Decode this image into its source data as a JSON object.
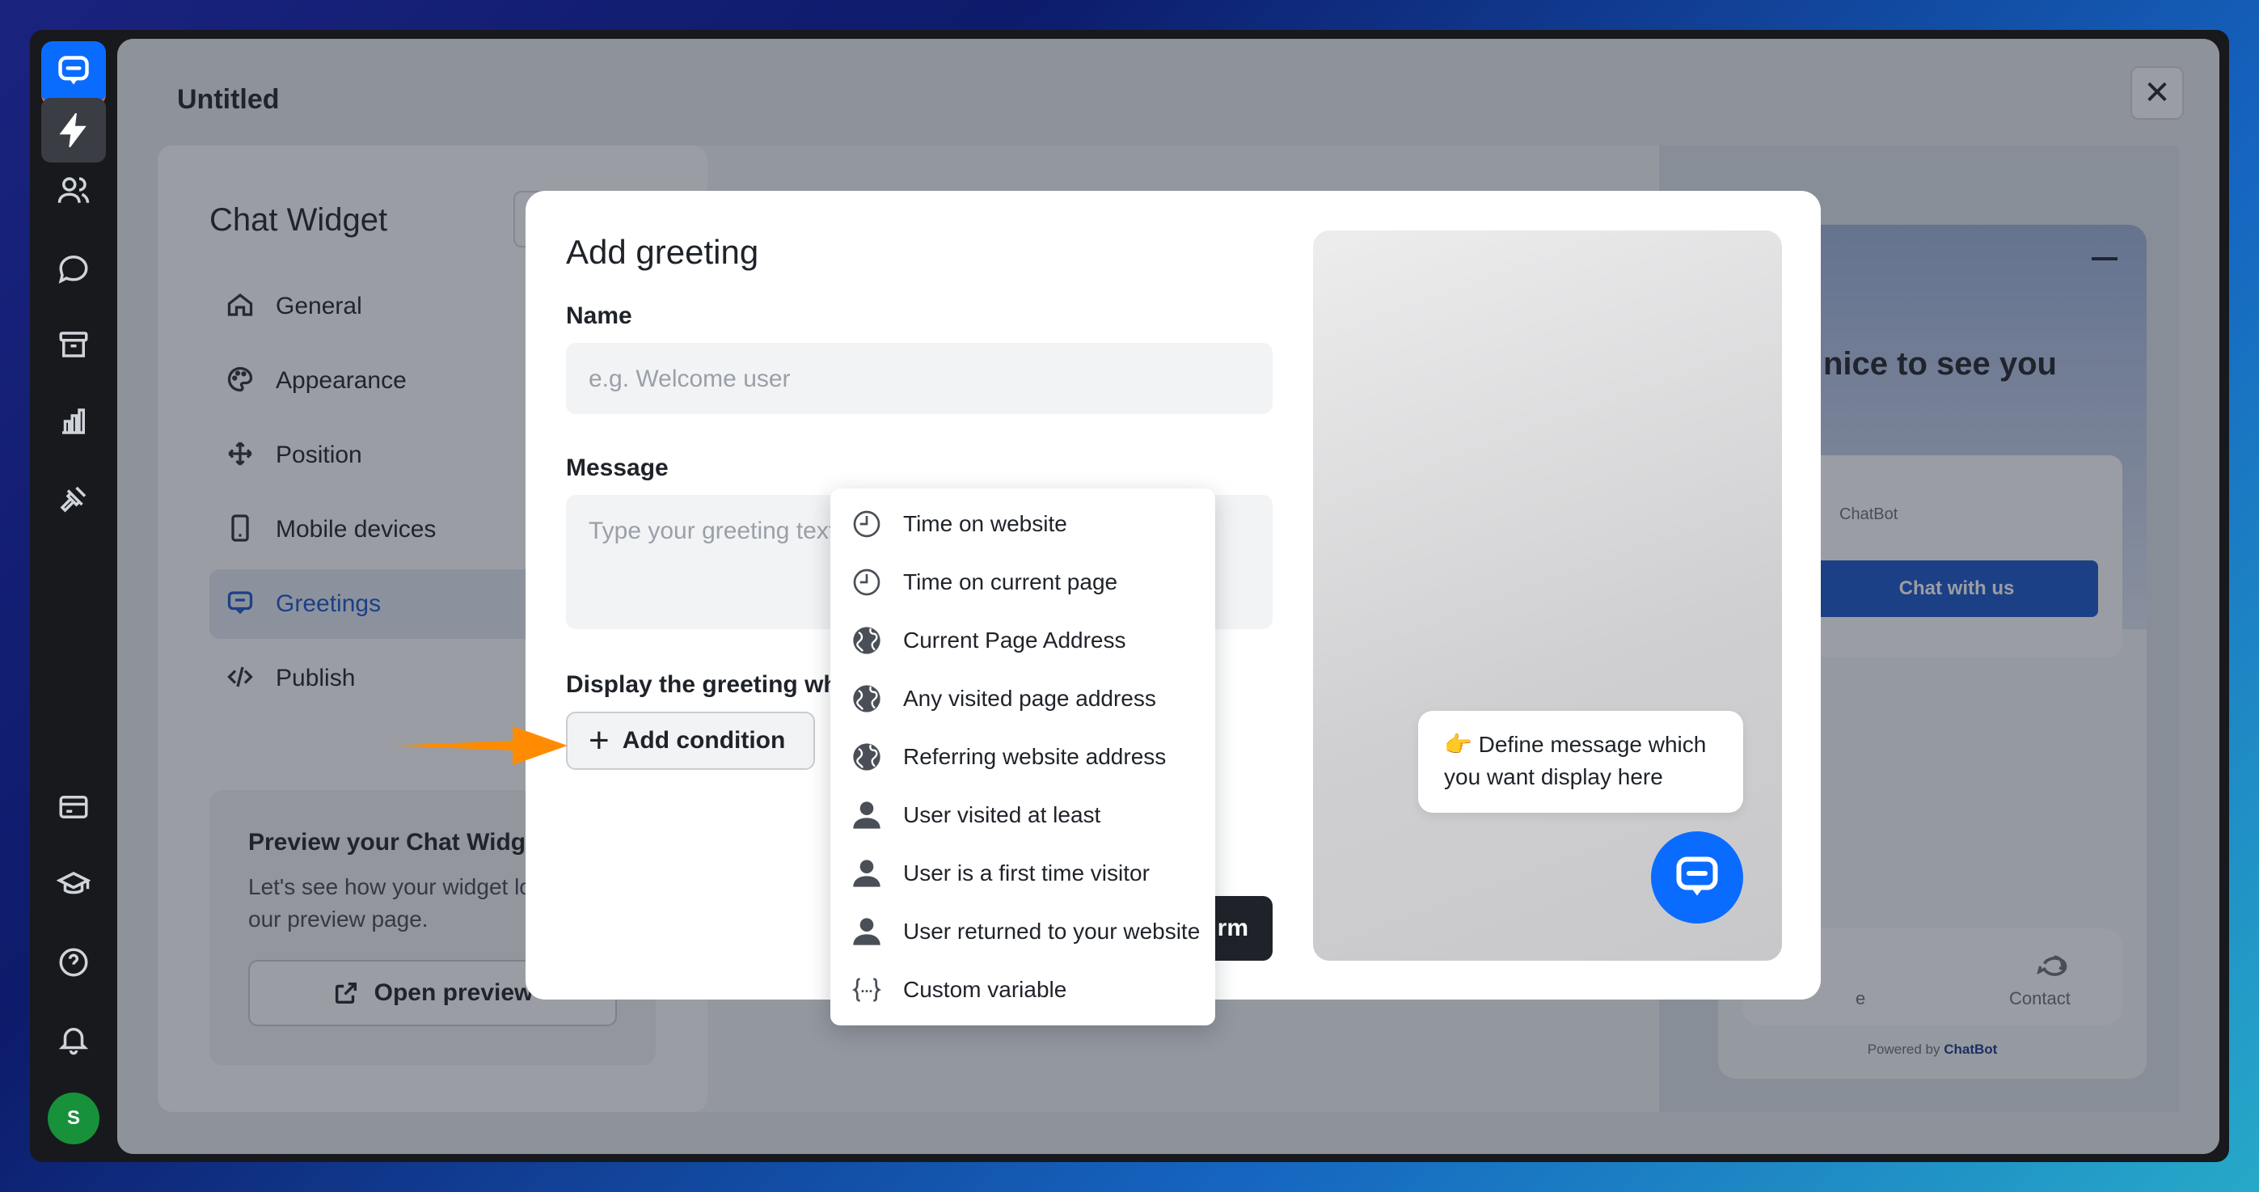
{
  "rail": {
    "avatar_initial": "S"
  },
  "panel": {
    "title": "Untitled",
    "close_label": "✕"
  },
  "settings": {
    "title": "Chat Widget",
    "nav": [
      {
        "label": "General",
        "icon": "home-icon"
      },
      {
        "label": "Appearance",
        "icon": "palette-icon"
      },
      {
        "label": "Position",
        "icon": "move-icon"
      },
      {
        "label": "Mobile devices",
        "icon": "mobile-icon"
      },
      {
        "label": "Greetings",
        "icon": "chat-icon",
        "active": true
      },
      {
        "label": "Publish",
        "icon": "code-icon"
      }
    ],
    "preview": {
      "title": "Preview your Chat Widget",
      "text": "Let's see how your widget looks on our preview page.",
      "button": "Open preview"
    }
  },
  "widget": {
    "hello": "nice to see you",
    "card_brand": "ChatBot",
    "chat_button": "Chat with us",
    "tab_home": "e",
    "tab_contact": "Contact",
    "powered_prefix": "Powered by",
    "powered_brand": "ChatBot"
  },
  "modal": {
    "title": "Add greeting",
    "name_label": "Name",
    "name_placeholder": "e.g. Welcome user",
    "message_label": "Message",
    "message_placeholder": "Type your greeting text",
    "display_label": "Display the greeting when",
    "add_condition": "Add condition",
    "confirm": "rm",
    "bubble_text": "👉 Define message which you want display here"
  },
  "dropdown": {
    "items": [
      {
        "label": "Time on website",
        "icon": "clock-icon"
      },
      {
        "label": "Time on current page",
        "icon": "clock-icon"
      },
      {
        "label": "Current Page Address",
        "icon": "globe-icon"
      },
      {
        "label": "Any visited page address",
        "icon": "globe-icon"
      },
      {
        "label": "Referring website address",
        "icon": "globe-icon"
      },
      {
        "label": "User visited at least",
        "icon": "user-icon"
      },
      {
        "label": "User is a first time visitor",
        "icon": "user-icon"
      },
      {
        "label": "User returned to your website",
        "icon": "user-icon"
      },
      {
        "label": "Custom variable",
        "icon": "variable-icon"
      }
    ]
  },
  "colors": {
    "accent": "#0a6cff",
    "active_nav": "#1a57c9",
    "arrow": "#ff8c00",
    "avatar": "#17913a"
  }
}
